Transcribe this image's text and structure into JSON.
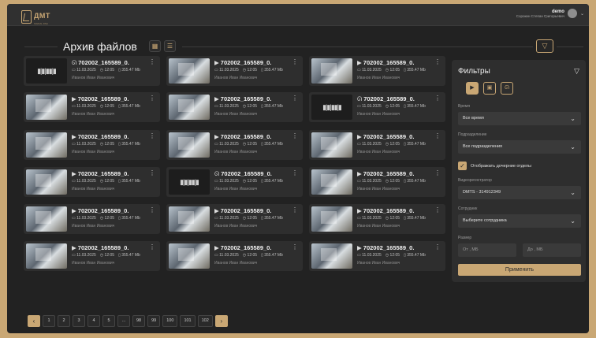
{
  "header": {
    "logo_text": "ДМТ",
    "logo_sub": "SIGNAL DNA",
    "user_login": "demo",
    "user_fio": "Сорокин Степан Григорьевич"
  },
  "page": {
    "title": "Архив файлов",
    "grid_view_icon": "grid-icon",
    "list_view_icon": "list-icon",
    "filter_toggle_icon": "filter-icon"
  },
  "cards": [
    {
      "type": "audio",
      "icon": "headphones-icon",
      "name": "702002_165589_0.",
      "date": "11.03.2025",
      "time": "12:05",
      "size": "355.47 Mb",
      "author": "Иванов Иван Иванович"
    },
    {
      "type": "video",
      "icon": "video-icon",
      "name": "702002_165589_0.",
      "date": "11.03.2025",
      "time": "12:05",
      "size": "355.47 Mb",
      "author": "Иванов Иван Иванович"
    },
    {
      "type": "video",
      "icon": "video-icon",
      "name": "702002_165589_0.",
      "date": "11.03.2025",
      "time": "12:05",
      "size": "355.47 Mb",
      "author": "Иванов Иван Иванович"
    },
    {
      "type": "video",
      "icon": "video-icon",
      "name": "702002_165589_0.",
      "date": "11.03.2025",
      "time": "12:05",
      "size": "355.47 Mb",
      "author": "Иванов Иван Иванович"
    },
    {
      "type": "video",
      "icon": "video-icon",
      "name": "702002_165589_0.",
      "date": "11.03.2025",
      "time": "12:05",
      "size": "355.47 Mb",
      "author": "Иванов Иван Иванович"
    },
    {
      "type": "audio",
      "icon": "headphones-icon",
      "name": "702002_165589_0.",
      "date": "11.03.2025",
      "time": "12:05",
      "size": "355.47 Mb",
      "author": "Иванов Иван Иванович"
    },
    {
      "type": "video",
      "icon": "video-icon",
      "name": "702002_165589_0.",
      "date": "11.03.2025",
      "time": "12:05",
      "size": "355.47 Mb",
      "author": "Иванов Иван Иванович"
    },
    {
      "type": "video",
      "icon": "video-icon",
      "name": "702002_165589_0.",
      "date": "11.03.2025",
      "time": "12:05",
      "size": "355.47 Mb",
      "author": "Иванов Иван Иванович"
    },
    {
      "type": "video",
      "icon": "video-icon",
      "name": "702002_165589_0.",
      "date": "11.03.2025",
      "time": "12:05",
      "size": "355.47 Mb",
      "author": "Иванов Иван Иванович"
    },
    {
      "type": "video",
      "icon": "video-icon",
      "name": "702002_165589_0.",
      "date": "11.03.2025",
      "time": "12:05",
      "size": "355.47 Mb",
      "author": "Иванов Иван Иванович"
    },
    {
      "type": "audio",
      "icon": "headphones-icon",
      "name": "702002_165589_0.",
      "date": "11.03.2025",
      "time": "12:05",
      "size": "355.47 Mb",
      "author": "Иванов Иван Иванович"
    },
    {
      "type": "video",
      "icon": "video-icon",
      "name": "702002_165589_0.",
      "date": "11.03.2025",
      "time": "12:05",
      "size": "355.47 Mb",
      "author": "Иванов Иван Иванович"
    },
    {
      "type": "video",
      "icon": "video-icon",
      "name": "702002_165589_0.",
      "date": "11.03.2025",
      "time": "12:05",
      "size": "355.47 Mb",
      "author": "Иванов Иван Иванович"
    },
    {
      "type": "video",
      "icon": "video-icon",
      "name": "702002_165589_0.",
      "date": "11.03.2025",
      "time": "12:05",
      "size": "355.47 Mb",
      "author": "Иванов Иван Иванович"
    },
    {
      "type": "video",
      "icon": "video-icon",
      "name": "702002_165589_0.",
      "date": "11.03.2025",
      "time": "12:05",
      "size": "355.47 Mb",
      "author": "Иванов Иван Иванович"
    },
    {
      "type": "video",
      "icon": "video-icon",
      "name": "702002_165589_0.",
      "date": "11.03.2025",
      "time": "12:05",
      "size": "355.47 Mb",
      "author": "Иванов Иван Иванович"
    },
    {
      "type": "video",
      "icon": "video-icon",
      "name": "702002_165589_0.",
      "date": "11.03.2025",
      "time": "12:05",
      "size": "355.47 Mb",
      "author": "Иванов Иван Иванович"
    },
    {
      "type": "video",
      "icon": "video-icon",
      "name": "702002_165589_0.",
      "date": "11.03.2025",
      "time": "12:05",
      "size": "355.47 Mb",
      "author": "Иванов Иван Иванович"
    }
  ],
  "filters": {
    "title": "Фильтры",
    "time_label": "Время",
    "time_value": "Все время",
    "dept_label": "Подразделение",
    "dept_value": "Все подразделения",
    "show_children_label": "Отображать дочерние отделы",
    "show_children_checked": true,
    "recorder_label": "Видеорегистратор",
    "recorder_value": "DMTS - 314912349",
    "employee_label": "Сотрудник",
    "employee_value": "Выберите сотрудника",
    "size_label": "Размер",
    "size_from_placeholder": "От , МБ",
    "size_to_placeholder": "До , МБ",
    "apply_label": "Применить"
  },
  "pagination": {
    "prev_icon": "chevron-left-icon",
    "next_icon": "chevron-right-icon",
    "pages": [
      "1",
      "2",
      "3",
      "4",
      "5",
      "...",
      "98",
      "99",
      "100",
      "101",
      "102"
    ]
  },
  "colors": {
    "accent": "#c9a774",
    "background": "#222222",
    "card": "#2e2e2e"
  }
}
